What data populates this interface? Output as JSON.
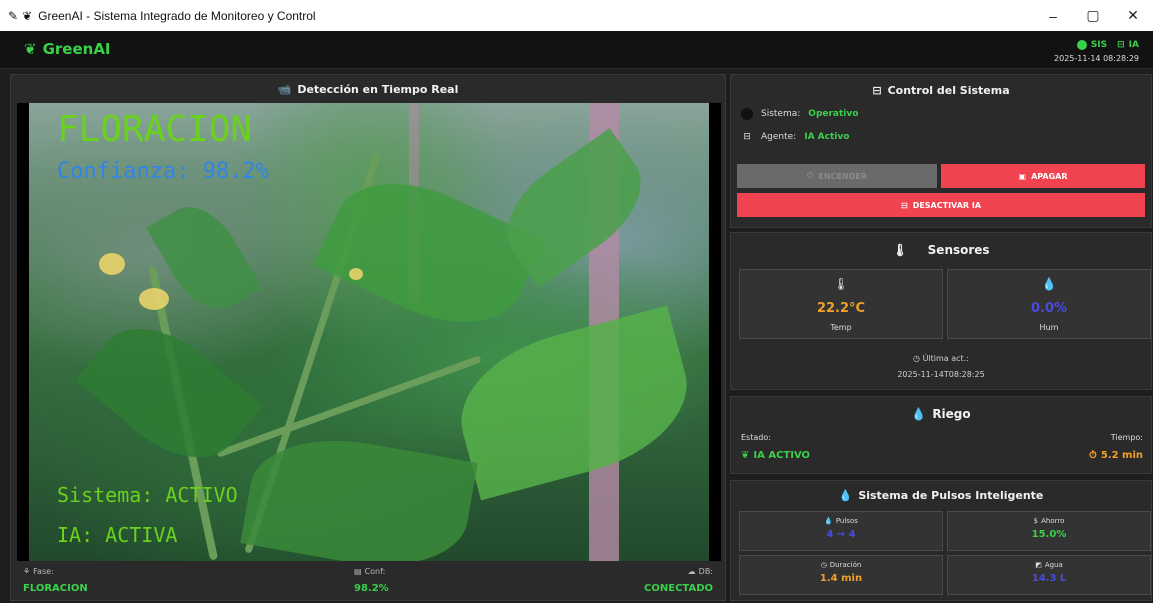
{
  "window": {
    "title": "GreenAI - Sistema Integrado de Monitoreo y Control",
    "controls": {
      "minimize": "–",
      "maximize": "▢",
      "close": "✕"
    }
  },
  "header": {
    "brand": "GreenAI",
    "status_sis": "SIS",
    "status_ia": "IA",
    "timestamp": "2025-11-14 08:28:29"
  },
  "video": {
    "title": "Detección en Tiempo Real",
    "overlay": {
      "fase": "FLORACION",
      "confianza": "Confianza: 98.2%",
      "sistema": "Sistema: ACTIVO",
      "ia": "IA: ACTIVA"
    },
    "footer": {
      "fase_label": "Fase:",
      "fase_value": "FLORACION",
      "conf_label": "Conf:",
      "conf_value": "98.2%",
      "db_label": "DB:",
      "db_value": "CONECTADO"
    }
  },
  "control": {
    "title": "Control del Sistema",
    "sistema_label": "Sistema:",
    "sistema_value": "Operativo",
    "agente_label": "Agente:",
    "agente_value": "IA Activo",
    "btn_encender": "ENCENDER",
    "btn_apagar": "APAGAR",
    "btn_desactivar_ia": "DESACTIVAR IA"
  },
  "sensores": {
    "title": "Sensores",
    "temp_value": "22.2°C",
    "temp_label": "Temp",
    "hum_value": "0.0%",
    "hum_label": "Hum",
    "ultima_label": "Última act.:",
    "ultima_value": "2025-11-14T08:28:25"
  },
  "riego": {
    "title": "Riego",
    "estado_label": "Estado:",
    "estado_value": "IA ACTIVO",
    "tiempo_label": "Tiempo:",
    "tiempo_value": "5.2 min"
  },
  "pulsos": {
    "title": "Sistema de Pulsos Inteligente",
    "pulsos_label": "Pulsos",
    "pulsos_value": "4 → 4",
    "ahorro_label": "Ahorro",
    "ahorro_value": "15.0%",
    "duracion_label": "Duración",
    "duracion_value": "1.4 min",
    "agua_label": "Agua",
    "agua_value": "14.3 L"
  },
  "colors": {
    "accent_green": "#3ad14a",
    "danger_red": "#f0424f",
    "temp_orange": "#f0a028",
    "hum_blue": "#4a4ae0",
    "panel_bg": "#2a2a2a"
  }
}
